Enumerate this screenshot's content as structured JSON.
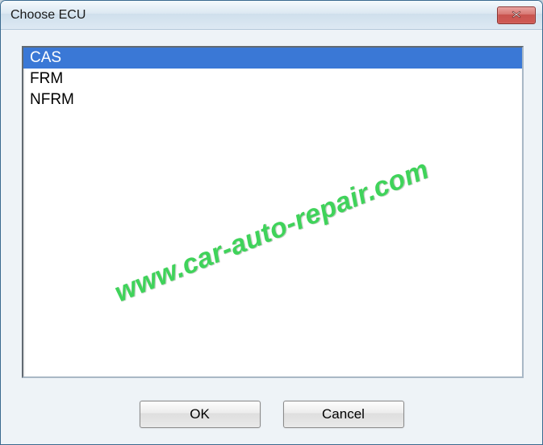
{
  "window": {
    "title": "Choose ECU"
  },
  "listbox": {
    "items": [
      {
        "label": "CAS",
        "selected": true
      },
      {
        "label": "FRM",
        "selected": false
      },
      {
        "label": "NFRM",
        "selected": false
      }
    ]
  },
  "buttons": {
    "ok": "OK",
    "cancel": "Cancel"
  },
  "watermark": {
    "text": "www.car-auto-repair.com"
  }
}
